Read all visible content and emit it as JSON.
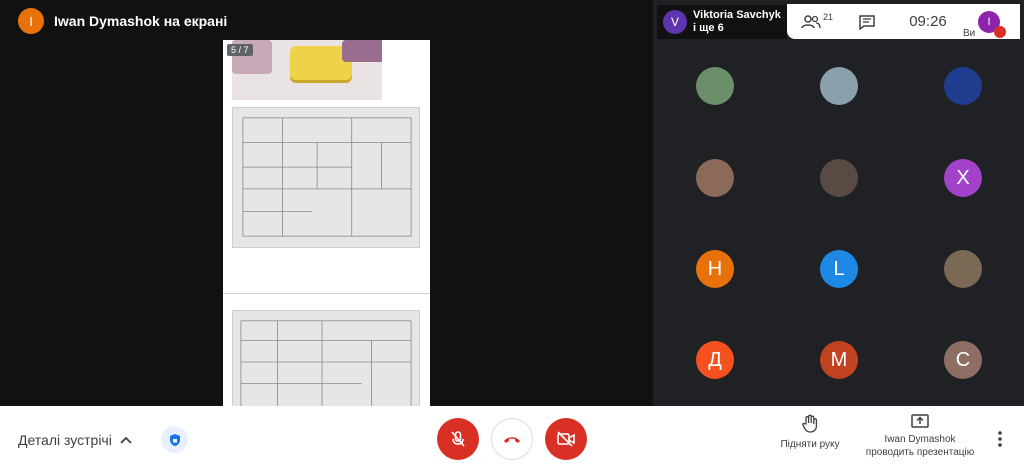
{
  "presenter": {
    "avatar_letter": "I",
    "title": "Iwan Dymashok на екрані"
  },
  "document": {
    "page_indicator": "5 / 7"
  },
  "pinned": {
    "avatar_letter": "V",
    "name": "Viktoria Savchyk",
    "others": "і ще 6"
  },
  "top_bar": {
    "participant_count": "21",
    "time": "09:26",
    "self_avatar_letter": "I",
    "self_label": "Ви"
  },
  "participants": [
    {
      "letter": "",
      "color": "#6b8f6b"
    },
    {
      "letter": "",
      "color": "#8aa0ad"
    },
    {
      "letter": "",
      "color": "#1f3c8f"
    },
    {
      "letter": "",
      "color": "#8b6a5a"
    },
    {
      "letter": "",
      "color": "#5a4a44"
    },
    {
      "letter": "X",
      "color": "#a142c9"
    },
    {
      "letter": "Н",
      "color": "#e8710a"
    },
    {
      "letter": "L",
      "color": "#1e88e5"
    },
    {
      "letter": "",
      "color": "#7a6a55"
    },
    {
      "letter": "Д",
      "color": "#f4511e"
    },
    {
      "letter": "M",
      "color": "#c1431f"
    },
    {
      "letter": "C",
      "color": "#8d6e63"
    }
  ],
  "bottom": {
    "details_label": "Деталі зустрічі",
    "raise_hand": "Підняти руку",
    "presenter_name": "Iwan Dymashok",
    "presenting": "проводить презентацію"
  }
}
